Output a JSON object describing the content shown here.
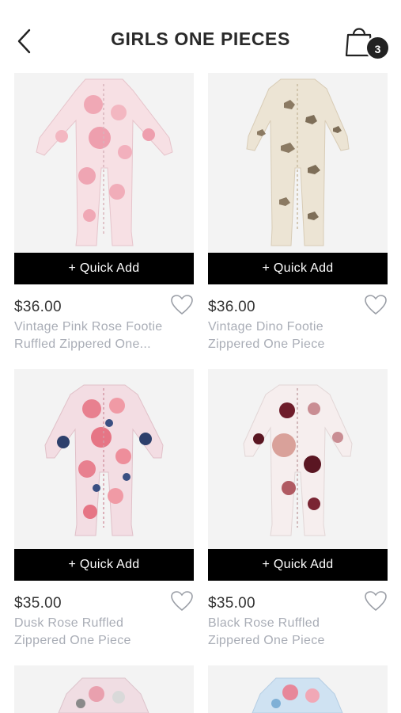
{
  "header": {
    "title": "GIRLS ONE PIECES",
    "cart_count": "3",
    "back_icon": "chevron-left-icon",
    "cart_icon": "shopping-bag-icon"
  },
  "products": [
    {
      "quick_add": "+ Quick Add",
      "price": "$36.00",
      "name_line1": "Vintage Pink Rose Footie",
      "name_line2": "Ruffled Zippered One...",
      "pattern": "pink-floral"
    },
    {
      "quick_add": "+ Quick Add",
      "price": "$36.00",
      "name_line1": "Vintage Dino Footie",
      "name_line2": "Zippered One Piece",
      "pattern": "dino"
    },
    {
      "quick_add": "+ Quick Add",
      "price": "$35.00",
      "name_line1": "Dusk Rose Ruffled",
      "name_line2": "Zippered One Piece",
      "pattern": "dusk-rose"
    },
    {
      "quick_add": "+ Quick Add",
      "price": "$35.00",
      "name_line1": "Black Rose Ruffled",
      "name_line2": "Zippered One Piece",
      "pattern": "black-rose"
    }
  ],
  "colors": {
    "button_bg": "#000000",
    "name_text": "#a9adb6",
    "image_bg": "#f3f3f3"
  }
}
